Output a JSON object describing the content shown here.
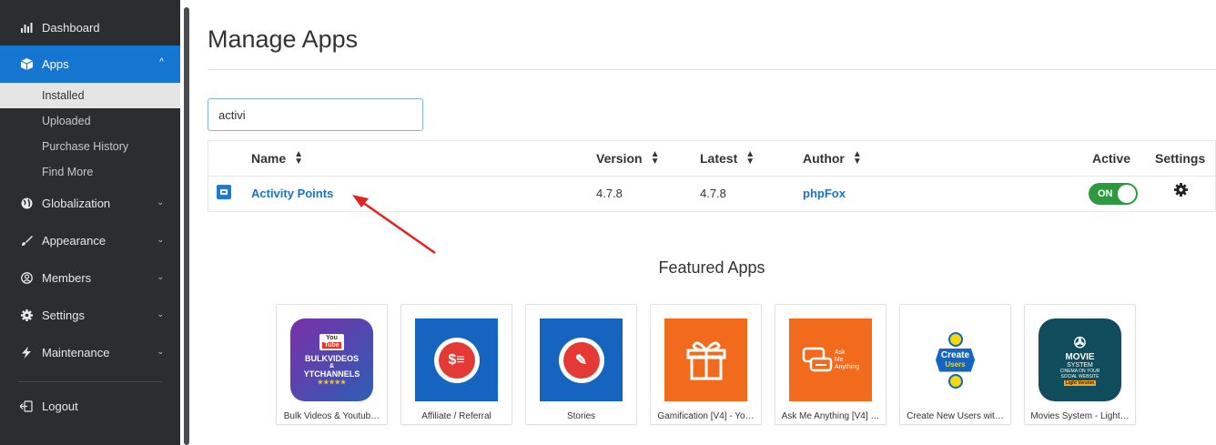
{
  "sidebar": {
    "items": [
      {
        "label": "Dashboard",
        "icon": "bar-chart-icon"
      },
      {
        "label": "Apps",
        "icon": "cube-icon"
      },
      {
        "label": "Globalization",
        "icon": "globe-icon"
      },
      {
        "label": "Appearance",
        "icon": "paint-brush-icon"
      },
      {
        "label": "Members",
        "icon": "user-circle-icon"
      },
      {
        "label": "Settings",
        "icon": "gear-icon"
      },
      {
        "label": "Maintenance",
        "icon": "bolt-icon"
      },
      {
        "label": "Logout",
        "icon": "logout-icon"
      }
    ],
    "apps_sub": [
      "Installed",
      "Uploaded",
      "Purchase History",
      "Find More"
    ]
  },
  "main": {
    "title": "Manage Apps",
    "search_value": "activi",
    "table": {
      "headers": {
        "name": "Name",
        "version": "Version",
        "latest": "Latest",
        "author": "Author",
        "active": "Active",
        "settings": "Settings"
      },
      "rows": [
        {
          "name": "Activity Points",
          "version": "4.7.8",
          "latest": "4.7.8",
          "author": "phpFox",
          "active_label": "ON"
        }
      ]
    },
    "featured_title": "Featured Apps",
    "featured": [
      {
        "name": "Bulk Videos & Youtub…",
        "thumb_lines": [
          "You",
          "Tube",
          "BULKVIDEOS",
          "&",
          "YTCHANNELS"
        ]
      },
      {
        "name": "Affiliate / Referral"
      },
      {
        "name": "Stories"
      },
      {
        "name": "Gamification [V4] - Yo…"
      },
      {
        "name": "Ask Me Anything [V4] …",
        "thumb_lines": [
          "Ask",
          "Me",
          "Anything"
        ]
      },
      {
        "name": "Create New Users wit…",
        "thumb_lines": [
          "Create",
          "Users"
        ]
      },
      {
        "name": "Movies System - Light…",
        "thumb_lines": [
          "MOVIE",
          "SYSTEM",
          "CINEMA ON YOUR",
          "SOCIAL WEBSITE",
          "Light Version"
        ]
      }
    ]
  },
  "colors": {
    "sidebar_bg": "#2b2d31",
    "accent": "#1476d1",
    "toggle_on": "#2e9a3f",
    "link": "#1a73c8"
  }
}
